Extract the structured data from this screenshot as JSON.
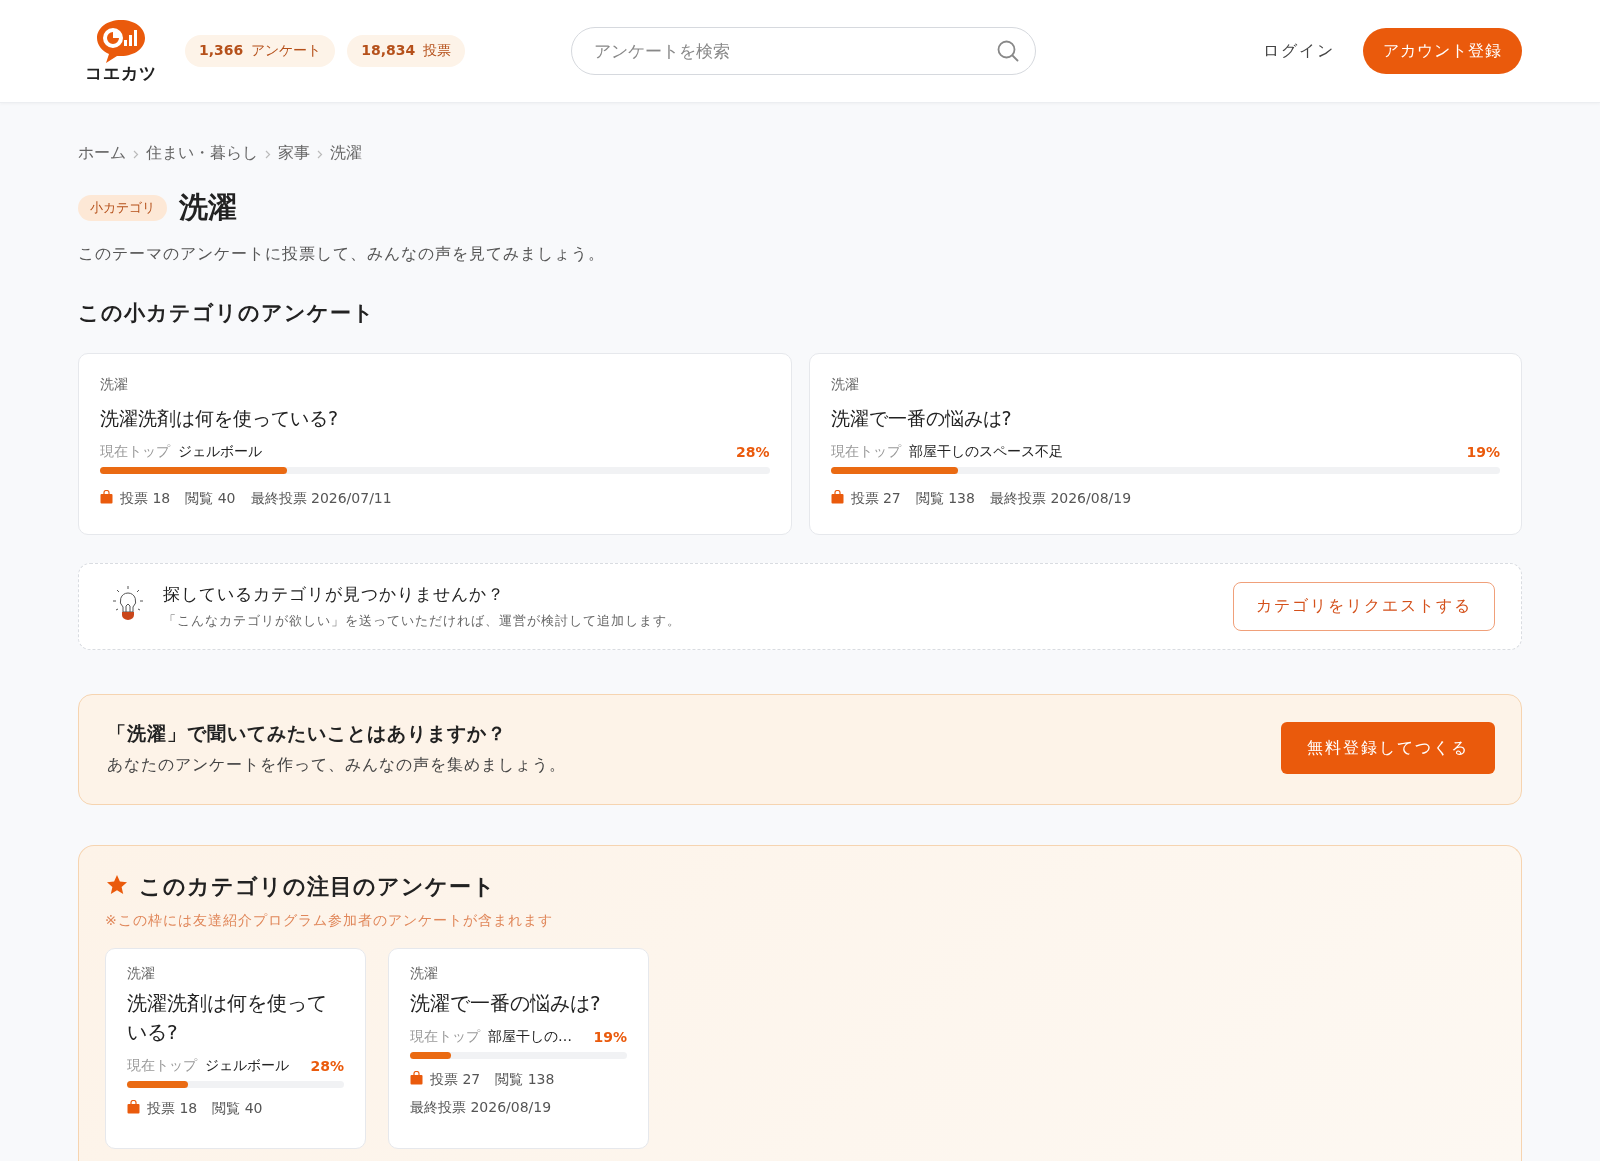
{
  "header": {
    "logo_text": "コエカツ",
    "stats": [
      {
        "value": "1,366",
        "label": "アンケート"
      },
      {
        "value": "18,834",
        "label": "投票"
      }
    ],
    "search": {
      "placeholder": "アンケートを検索"
    },
    "login": "ログイン",
    "signup": "アカウント登録"
  },
  "breadcrumb": [
    "ホーム",
    "住まい・暮らし",
    "家事",
    "洗濯"
  ],
  "page": {
    "badge": "小カテゴリ",
    "title": "洗濯",
    "description": "このテーマのアンケートに投票して、みんなの声を見てみましょう。"
  },
  "section_title": "この小カテゴリのアンケート",
  "surveys": [
    {
      "category": "洗濯",
      "question": "洗濯洗剤は何を使っている?",
      "top_label": "現在トップ",
      "top_choice": "ジェルボール",
      "percent": "28%",
      "level": 0.28,
      "votes_label": "投票",
      "votes": "18",
      "views_label": "閲覧",
      "views": "40",
      "last_label": "最終投票",
      "last": "2026/07/11"
    },
    {
      "category": "洗濯",
      "question": "洗濯で一番の悩みは?",
      "top_label": "現在トップ",
      "top_choice": "部屋干しのスペース不足",
      "percent": "19%",
      "level": 0.19,
      "votes_label": "投票",
      "votes": "27",
      "views_label": "閲覧",
      "views": "138",
      "last_label": "最終投票",
      "last": "2026/08/19"
    }
  ],
  "request": {
    "title": "探しているカテゴリが見つかりませんか？",
    "text": "「こんなカテゴリが欲しい」を送っていただければ、運営が検討して追加します。",
    "button": "カテゴリをリクエストする"
  },
  "cta": {
    "title": "「洗濯」で聞いてみたいことはありますか？",
    "text": "あなたのアンケートを作って、みんなの声を集めましょう。",
    "button": "無料登録してつくる"
  },
  "featured": {
    "title": "このカテゴリの注目のアンケート",
    "note": "※この枠には友達紹介プログラム参加者のアンケートが含まれます",
    "cards": [
      {
        "category": "洗濯",
        "question": "洗濯洗剤は何を使っている?",
        "top_label": "現在トップ",
        "top_choice": "ジェルボール",
        "percent": "28%",
        "level": 0.28,
        "votes_label": "投票",
        "votes": "18",
        "views_label": "閲覧",
        "views": "40"
      },
      {
        "category": "洗濯",
        "question": "洗濯で一番の悩みは?",
        "top_label": "現在トップ",
        "top_choice": "部屋干しの…",
        "percent": "19%",
        "level": 0.19,
        "votes_label": "投票",
        "votes": "27",
        "views_label": "閲覧",
        "views": "138",
        "last_label": "最終投票",
        "last": "2026/08/19"
      }
    ]
  }
}
